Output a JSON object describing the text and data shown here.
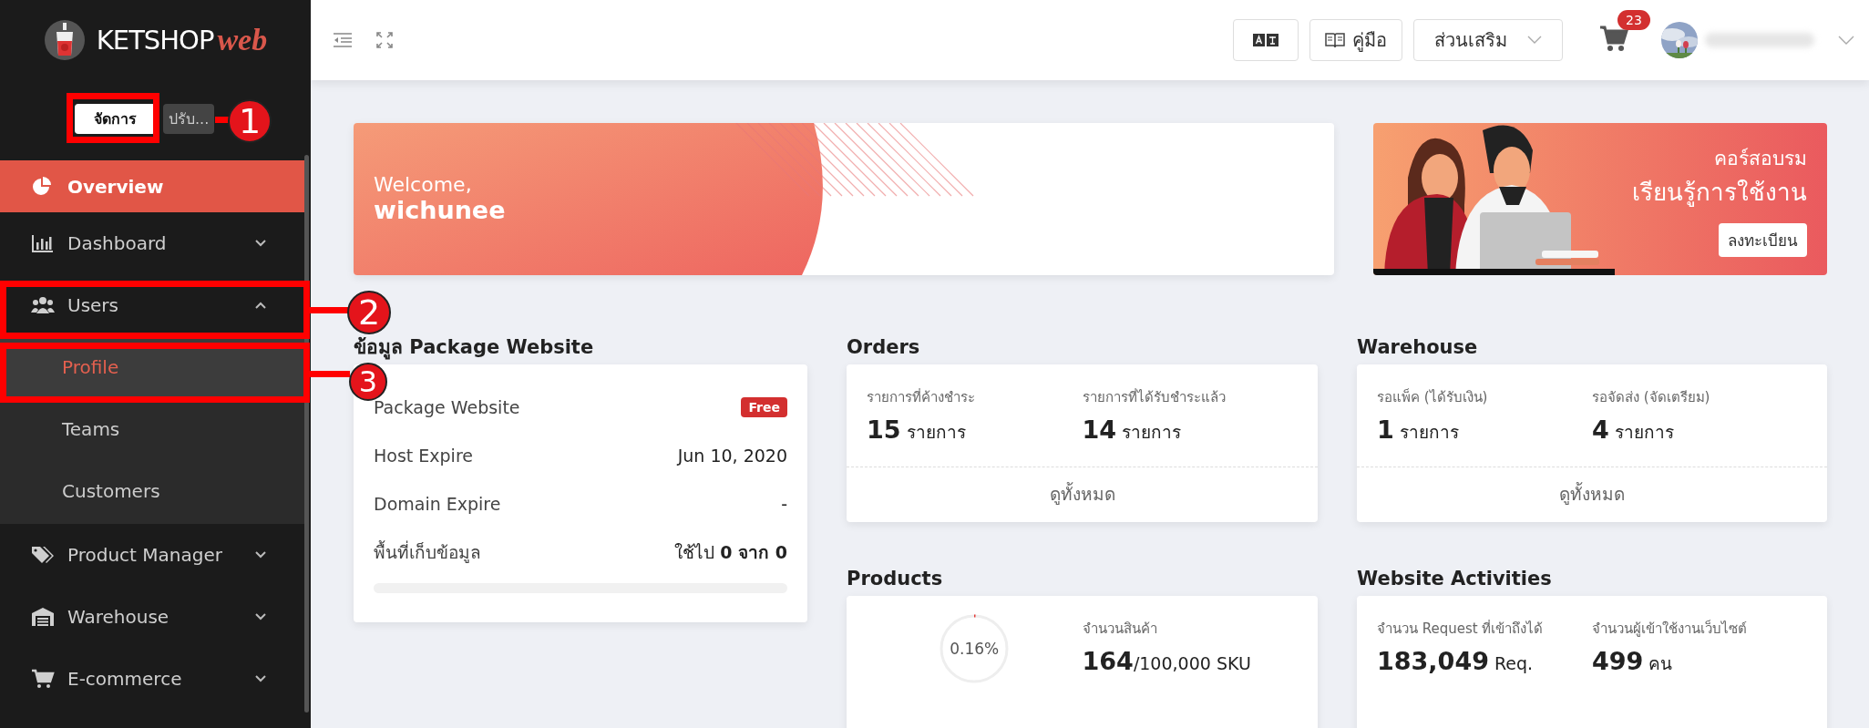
{
  "sidebar": {
    "logo": {
      "text": "KETSHOP",
      "accent": "web"
    },
    "mode_toggle": [
      {
        "label": "จัดการ",
        "selected": true
      },
      {
        "label": "ปรับ...",
        "selected": false
      }
    ],
    "items": [
      {
        "label": "Overview",
        "selected": true
      },
      {
        "label": "Dashboard",
        "selected": false,
        "expanded": false
      },
      {
        "label": "Users",
        "selected": false,
        "expanded": true,
        "children": [
          {
            "label": "Profile",
            "selected": true
          },
          {
            "label": "Teams",
            "selected": false
          },
          {
            "label": "Customers",
            "selected": false
          }
        ]
      },
      {
        "label": "Product Manager",
        "selected": false,
        "expanded": false
      },
      {
        "label": "Warehouse",
        "selected": false,
        "expanded": false
      },
      {
        "label": "E-commerce",
        "selected": false,
        "expanded": false
      }
    ]
  },
  "topbar": {
    "manual_button": "คู่มือ",
    "addons_dropdown": "ส่วนเสริม",
    "cart_badge": "23"
  },
  "welcome": {
    "greeting": "Welcome,",
    "name": "wichunee"
  },
  "course_banner": {
    "kicker": "คอร์สอบรม",
    "title": "เรียนรู้การใช้งาน",
    "button": "ลงทะเบียน"
  },
  "package": {
    "title": "ข้อมูล Package Website",
    "rows": [
      {
        "kind": "badge",
        "label": "Package Website",
        "value": "Free"
      },
      {
        "kind": "text",
        "label": "Host Expire",
        "value": "Jun 10, 2020"
      },
      {
        "kind": "text",
        "label": "Domain Expire",
        "value": "-"
      },
      {
        "kind": "text",
        "label": "พื้นที่เก็บข้อมูล",
        "value": "ใช้ไป **0 จาก 0**"
      }
    ],
    "level": 0
  },
  "orders": {
    "title": "Orders",
    "stats": [
      {
        "label": "รายการที่ค้างชำระ",
        "value": "15",
        "unit": "รายการ"
      },
      {
        "label": "รายการที่ได้รับชำระแล้ว",
        "value": "14",
        "unit": "รายการ"
      }
    ],
    "link": "ดูทั้งหมด"
  },
  "warehouse": {
    "title": "Warehouse",
    "stats": [
      {
        "label": "รอแพ็ค (ได้รับเงิน)",
        "value": "1",
        "unit": "รายการ"
      },
      {
        "label": "รอจัดส่ง (จัดเตรียม)",
        "value": "4",
        "unit": "รายการ"
      }
    ],
    "link": "ดูทั้งหมด"
  },
  "products": {
    "title": "Products",
    "ring_text": "0.16%",
    "level": 0.0016,
    "label": "จำนวนสินค้า",
    "value": "164",
    "unit": "/100,000 SKU"
  },
  "activities": {
    "title": "Website Activities",
    "stats": [
      {
        "label": "จำนวน Request ที่เข้าถึงได้",
        "value": "183,049",
        "unit": "Req."
      },
      {
        "label": "จำนวนผู้เข้าใช้งานเว็บไซต์",
        "value": "499",
        "unit": "คน"
      }
    ]
  },
  "annotations": [
    {
      "number": "1"
    },
    {
      "number": "2"
    },
    {
      "number": "3"
    }
  ]
}
